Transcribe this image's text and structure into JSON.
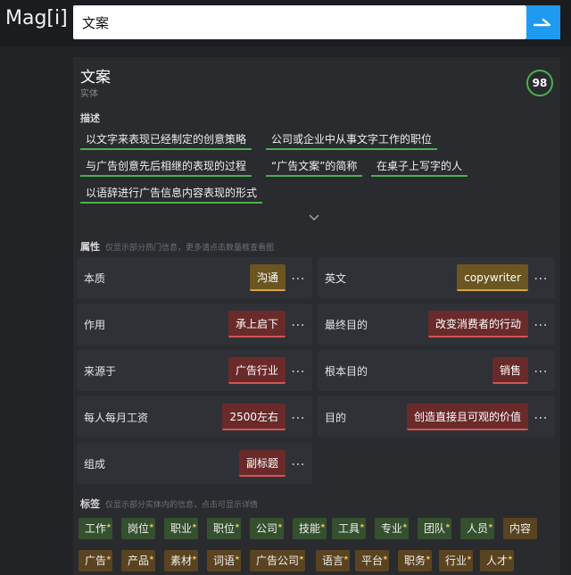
{
  "header": {
    "logo": "Mag[i]",
    "search_value": "文案"
  },
  "entity": {
    "title": "文案",
    "type": "实体",
    "score": "98"
  },
  "description": {
    "label": "描述",
    "items": [
      "以文字来表现已经制定的创意策略",
      "公司或企业中从事文字工作的职位",
      "与广告创意先后相继的表现的过程",
      "“广告文案”的简称",
      "在桌子上写字的人",
      "以语辞进行广告信息内容表现的形式"
    ]
  },
  "properties": {
    "label": "属性",
    "hint": "仅显示部分热门信息，更多请点击数量框查看图",
    "items": [
      {
        "key": "本质",
        "value": "沟通",
        "style": "gold"
      },
      {
        "key": "英文",
        "value": "copywriter",
        "style": "gold"
      },
      {
        "key": "作用",
        "value": "承上启下",
        "style": "red"
      },
      {
        "key": "最终目的",
        "value": "改变消费者的行动",
        "style": "red"
      },
      {
        "key": "来源于",
        "value": "广告行业",
        "style": "red"
      },
      {
        "key": "根本目的",
        "value": "销售",
        "style": "red"
      },
      {
        "key": "每人每月工资",
        "value": "2500左右",
        "style": "red"
      },
      {
        "key": "目的",
        "value": "创造直接且可观的价值",
        "style": "red"
      },
      {
        "key": "组成",
        "value": "副标题",
        "style": "red"
      }
    ],
    "more_glyph": "⋯"
  },
  "tags": {
    "label": "标签",
    "hint": "仅显示部分实体内的信息，点击可显示详情",
    "row1": [
      "工作",
      "岗位",
      "职业",
      "职位",
      "公司",
      "技能",
      "工具",
      "专业",
      "团队",
      "人员",
      "内容"
    ],
    "row2": [
      "广告",
      "产品",
      "素材",
      "词语",
      "广告公司",
      "语言",
      "平台",
      "职务",
      "行业",
      "人才"
    ]
  },
  "colors": {
    "accent": "#1e9af0",
    "score_ring": "#4caf50",
    "desc_underline": "#4caf50",
    "gold_value": "#d9a640",
    "red_value": "#d25555"
  }
}
